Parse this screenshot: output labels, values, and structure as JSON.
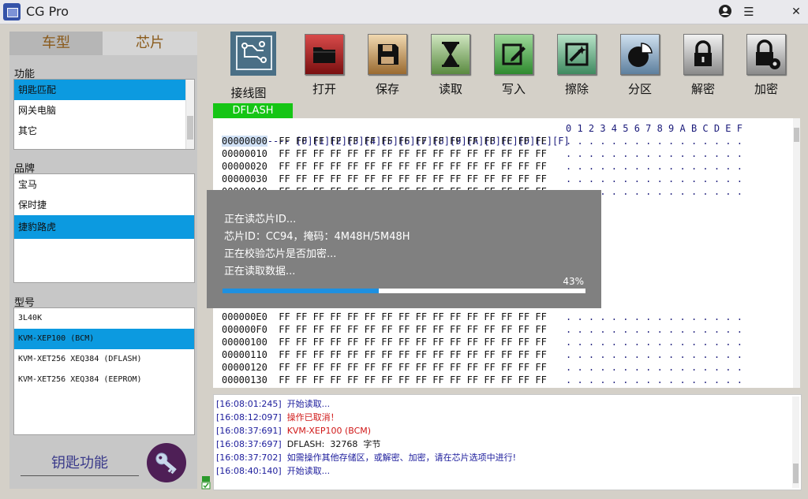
{
  "app": {
    "title": "CG Pro"
  },
  "left": {
    "tabs": [
      "车型",
      "芯片"
    ],
    "function_label": "功能",
    "function_items": [
      "钥匙匹配",
      "网关电脑",
      "其它"
    ],
    "function_selected": 0,
    "brand_label": "品牌",
    "brand_items": [
      "宝马",
      "保时捷",
      "捷豹路虎"
    ],
    "brand_selected": 2,
    "model_label": "型号",
    "model_items": [
      "3L40K",
      "KVM-XEP100 (BCM)",
      "KVM-XET256 XEQ384 (DFLASH)",
      "KVM-XET256 XEQ384 (EEPROM)"
    ],
    "model_selected": 1,
    "key_function": "钥匙功能"
  },
  "toolbar": {
    "wiring": "接线图",
    "open": "打开",
    "save": "保存",
    "read": "读取",
    "write": "写入",
    "erase": "擦除",
    "partition": "分区",
    "decrypt": "解密",
    "encrypt": "加密"
  },
  "hex": {
    "tab_label": "DFLASH",
    "header_prefix": "--------",
    "header_cols": [
      "0",
      "1",
      "2",
      "3",
      "4",
      "5",
      "6",
      "7",
      "8",
      "9",
      "A",
      "B",
      "C",
      "D",
      "E",
      "F"
    ],
    "ascii_header": "0 1 2 3 4 5 6 7 8 9 A B C D E F",
    "byte_value": "FF",
    "ascii_fill": ". . . . . . . . . . . . . . . .",
    "top_rows": [
      "00000000",
      "00000010",
      "00000020",
      "00000030",
      "00000040"
    ],
    "bottom_rows": [
      "000000E0",
      "000000F0",
      "00000100",
      "00000110",
      "00000120",
      "00000130"
    ]
  },
  "dialog": {
    "lines": [
      "正在读芯片ID...",
      "芯片ID：CC94，掩码：4M48H/5M48H",
      "正在校验芯片是否加密...",
      "正在读取数据..."
    ],
    "percent_text": "43%",
    "progress": 0.43
  },
  "log": [
    {
      "time": "[16:08:01:245]",
      "msg": "开始读取...",
      "color": "#1c1c9c"
    },
    {
      "time": "[16:08:12:097]",
      "msg": "操作已取消！",
      "color": "#d01818"
    },
    {
      "time": "[16:08:37:691]",
      "msg": "KVM-XEP100 (BCM)",
      "color": "#d01818"
    },
    {
      "time": "[16:08:37:697]",
      "msg": "DFLASH:  32768  字节",
      "color": "#111111"
    },
    {
      "time": "[16:08:37:702]",
      "msg": "如需操作其他存储区，或解密、加密，请在芯片选项中进行!",
      "color": "#1c1c9c"
    },
    {
      "time": "[16:08:40:140]",
      "msg": "开始读取...",
      "color": "#1c1c9c"
    }
  ],
  "colors": {
    "selection": "#0c9ae0",
    "dflash_tab": "#15c515",
    "progress_fill": "#1e90e0",
    "dialog_bg": "#808080"
  }
}
